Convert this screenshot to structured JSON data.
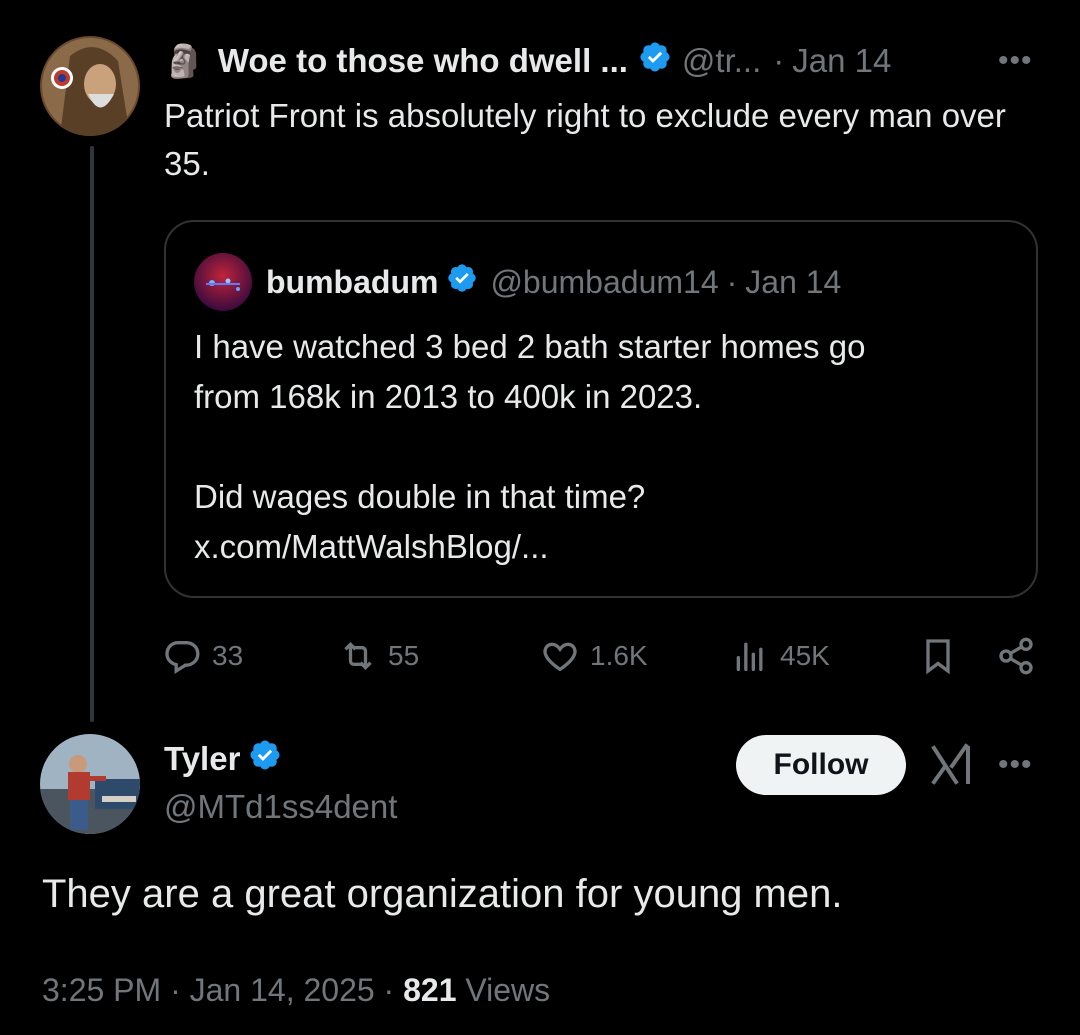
{
  "tweet1": {
    "author_emoji": "🗿",
    "display_name": "Woe to those who dwell ...",
    "handle": "@tr...",
    "separator": "·",
    "date": "Jan 14",
    "text": "Patriot Front is absolutely right to exclude every man over 35.",
    "more_label": "•••",
    "quote": {
      "display_name": "bumbadum",
      "handle": "@bumbadum14",
      "separator": "·",
      "date": "Jan 14",
      "text": "I have watched 3 bed 2 bath starter homes go\nfrom 168k in 2013 to 400k in 2023.\n\nDid wages double in that time?\nx.com/MattWalshBlog/..."
    },
    "actions": {
      "replies": "33",
      "reposts": "55",
      "likes": "1.6K",
      "views": "45K"
    }
  },
  "tweet2": {
    "display_name": "Tyler",
    "handle": "@MTd1ss4dent",
    "follow_label": "Follow",
    "more_label": "•••",
    "text": "They are a great organization for young men.",
    "time": "3:25 PM",
    "separator": "·",
    "date": "Jan 14, 2025",
    "separator2": "·",
    "views_count": "821",
    "views_label": "Views"
  },
  "colors": {
    "background": "#000000",
    "text": "#e7e9ea",
    "muted": "#71767b",
    "verified": "#1d9bf0",
    "border": "#2f3336",
    "follow_bg": "#eff3f4"
  },
  "icons": [
    "reply-icon",
    "repost-icon",
    "like-icon",
    "views-icon",
    "bookmark-icon",
    "share-icon",
    "verified-icon",
    "grok-icon",
    "more-icon"
  ]
}
